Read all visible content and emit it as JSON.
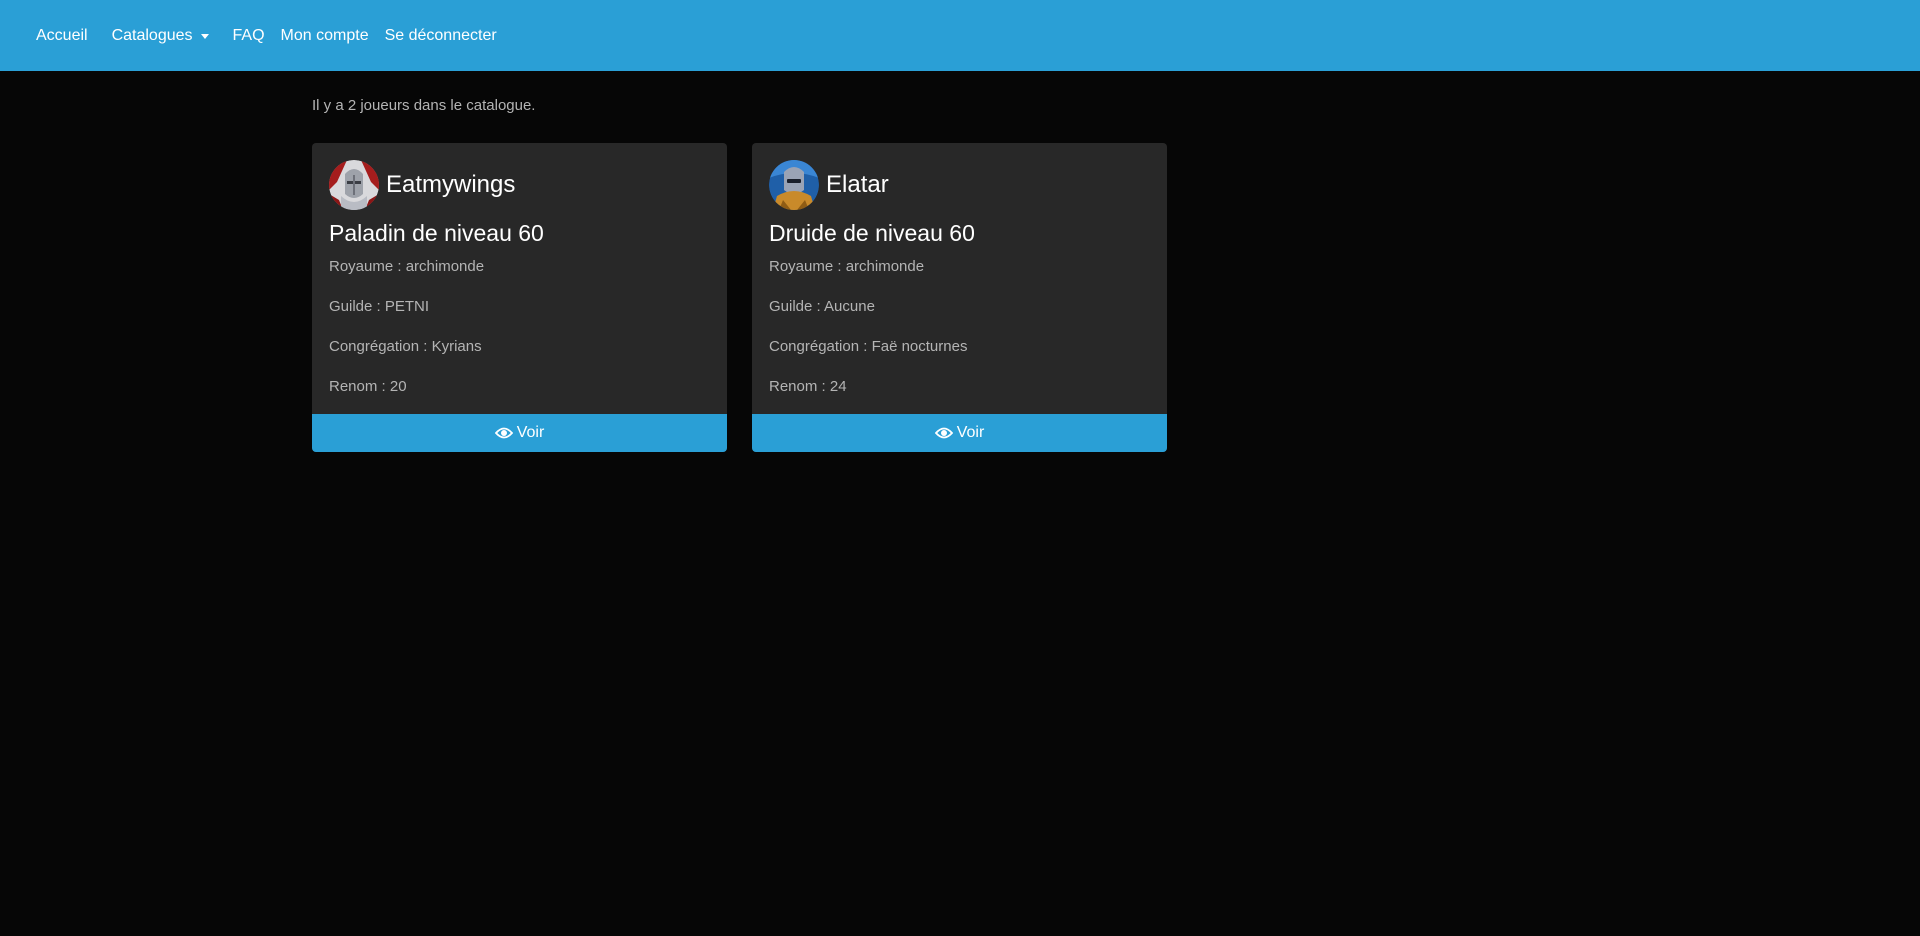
{
  "nav": {
    "home": "Accueil",
    "catalogues": "Catalogues",
    "faq": "FAQ",
    "account": "Mon compte",
    "logout": "Se déconnecter"
  },
  "summary": "Il y a 2 joueurs dans le catalogue.",
  "players": [
    {
      "name": "Eatmywings",
      "class_title": "Paladin de niveau 60",
      "realm": "Royaume : archimonde",
      "guild": "Guilde : PETNI",
      "covenant": "Congrégation : Kyrians",
      "renown": "Renom : 20",
      "button": "Voir",
      "avatar_icon": "paladin-portrait",
      "avatar_colors": [
        "#9b1c1c",
        "#c7c9cf"
      ]
    },
    {
      "name": "Elatar",
      "class_title": "Druide de niveau 60",
      "realm": "Royaume : archimonde",
      "guild": "Guilde : Aucune",
      "covenant": "Congrégation : Faë nocturnes",
      "renown": "Renom : 24",
      "button": "Voir",
      "avatar_icon": "druid-portrait",
      "avatar_colors": [
        "#2c6fb3",
        "#c98a2a"
      ]
    }
  ],
  "colors": {
    "accent": "#2a9fd6",
    "background": "#060606",
    "card": "#282828"
  }
}
